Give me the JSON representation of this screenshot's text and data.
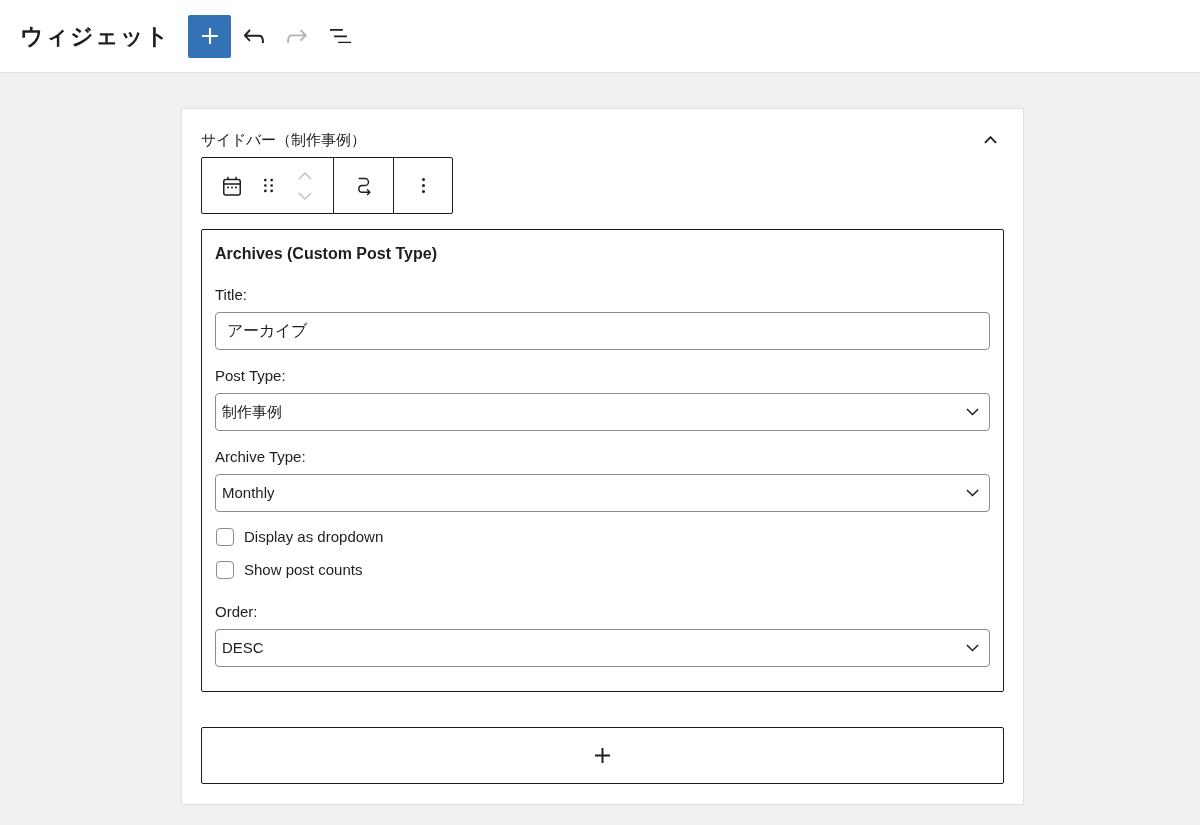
{
  "header": {
    "title": "ウィジェット",
    "tools": [
      {
        "kind": "inserter",
        "disabled": false
      },
      {
        "kind": "undo",
        "disabled": false
      },
      {
        "kind": "redo",
        "disabled": true
      },
      {
        "kind": "list-view",
        "disabled": false
      }
    ]
  },
  "widget_area": {
    "title": "サイドバー（制作事例）",
    "expanded": true,
    "block_toolbar": {
      "move_up": {
        "disabled": true
      },
      "move_down": {
        "disabled": true
      }
    },
    "widget": {
      "title": "Archives (Custom Post Type)",
      "fields": [
        {
          "kind": "text",
          "label": "Title:",
          "value": "アーカイブ"
        },
        {
          "kind": "select",
          "label": "Post Type:",
          "value": "制作事例"
        },
        {
          "kind": "select",
          "label": "Archive Type:",
          "value": "Monthly"
        },
        {
          "kind": "checkbox",
          "label": "Display as dropdown",
          "checked": false
        },
        {
          "kind": "checkbox",
          "label": "Show post counts",
          "checked": false
        },
        {
          "kind": "select",
          "label": "Order:",
          "value": "DESC"
        }
      ]
    }
  }
}
